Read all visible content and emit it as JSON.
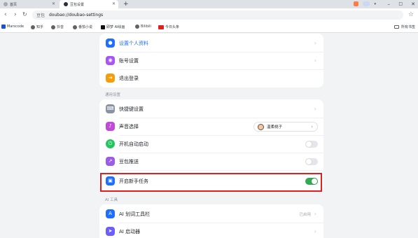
{
  "browser": {
    "tabs": [
      {
        "title": "首页"
      },
      {
        "title": "豆包设置"
      }
    ],
    "new_tab": "+",
    "nav": {
      "back": "‹",
      "forward": "›",
      "reload": "↻"
    },
    "address": {
      "site": "豆包",
      "url": "doubao://doubao-settings"
    },
    "window": {
      "dropdown": "▾",
      "minimize": "–",
      "maximize": "□",
      "close": "✕"
    },
    "bookmarks": [
      {
        "label": "Marscode",
        "color": "#1d4ed8"
      },
      {
        "label": "知乎",
        "color": "#5f6368"
      },
      {
        "label": "抖音",
        "color": "#5f6368"
      },
      {
        "label": "番茄小说",
        "color": "#5f6368"
      },
      {
        "label": "即梦 AI绘画",
        "color": "#5f6368"
      },
      {
        "label": "Bilibili",
        "color": "#5f6368"
      },
      {
        "label": "今日头条",
        "color": "#e02020"
      }
    ],
    "folder_label": "所有书签"
  },
  "account_card": {
    "items": [
      {
        "label": "设置个人资料",
        "icon": "user-icon",
        "color": "#1e6fff",
        "label_color": "#1e6fff"
      },
      {
        "label": "账号设置",
        "icon": "account-icon",
        "color": "#a855f7"
      },
      {
        "label": "退出登录",
        "icon": "logout-icon",
        "color": "#f59e0b"
      }
    ]
  },
  "general": {
    "title": "通用设置",
    "items": [
      {
        "label": "快捷键设置",
        "icon": "keyboard-icon",
        "color": "#8a93a6",
        "control": "chevron"
      },
      {
        "label": "声音选择",
        "icon": "sound-icon",
        "color": "#c14ad6",
        "control": "select",
        "select_value": "温柔桃子"
      },
      {
        "label": "开机自动启动",
        "icon": "power-icon",
        "color": "#22c55e",
        "control": "toggle",
        "on": false
      },
      {
        "label": "豆包推送",
        "icon": "push-icon",
        "color": "#9b5de5",
        "control": "toggle",
        "on": false
      },
      {
        "label": "开启新手任务",
        "icon": "gift-icon",
        "color": "#1e6fff",
        "control": "toggle",
        "on": true
      }
    ]
  },
  "ai_tools": {
    "title": "AI 工具",
    "items": [
      {
        "label": "AI 划词工具栏",
        "icon": "ai-text-icon",
        "color": "#1e6fff",
        "status": "已启用"
      },
      {
        "label": "AI 启动器",
        "icon": "rocket-icon",
        "color": "#6d5dfc"
      }
    ]
  },
  "chevron": "›"
}
